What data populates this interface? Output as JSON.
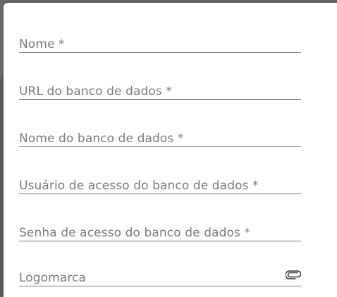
{
  "form": {
    "fields": [
      {
        "label": "Nome *"
      },
      {
        "label": "URL do banco de dados *"
      },
      {
        "label": "Nome do banco de dados *"
      },
      {
        "label": "Usuário de acesso do banco de dados *"
      },
      {
        "label": "Senha de acesso do banco de dados *"
      },
      {
        "label": "Logomarca",
        "icon": "paperclip-icon"
      }
    ]
  }
}
